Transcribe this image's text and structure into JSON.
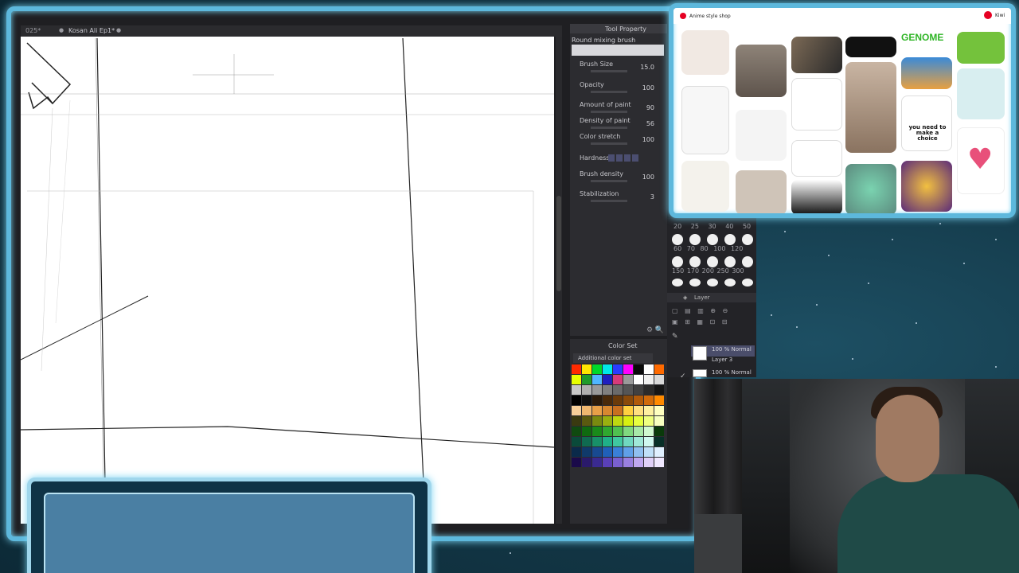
{
  "canvas_tabs": [
    {
      "label": "025*",
      "active": false
    },
    {
      "label": "Kosan Ali Ep1*",
      "active": true
    }
  ],
  "tool_property": {
    "title": "Tool Property",
    "brush_name": "Round mixing brush",
    "properties": [
      {
        "label": "Brush Size",
        "value": "15.0"
      },
      {
        "label": "Opacity",
        "value": "100"
      },
      {
        "label": "Amount of paint",
        "value": "90"
      },
      {
        "label": "Density of paint",
        "value": "56"
      },
      {
        "label": "Color stretch",
        "value": "100"
      },
      {
        "label": "Hardness",
        "value": ""
      },
      {
        "label": "Brush density",
        "value": "100"
      },
      {
        "label": "Stabilization",
        "value": "3"
      }
    ]
  },
  "brush_sizes": {
    "row1": [
      "20",
      "25",
      "30",
      "40",
      "50"
    ],
    "row2": [
      "60",
      "70",
      "80",
      "100",
      "120"
    ],
    "row3": [
      "150",
      "170",
      "200",
      "250",
      "300"
    ]
  },
  "layer_panel": {
    "title": "Layer",
    "layers": [
      {
        "mode": "100 % Normal",
        "name": "Layer 3"
      },
      {
        "mode": "100 % Normal",
        "name": ""
      }
    ]
  },
  "color_set": {
    "title": "Color Set",
    "selected_set": "Additional color set",
    "swatches": [
      "#ff2a00",
      "#ffe500",
      "#00d82a",
      "#00e8e8",
      "#2a3bff",
      "#ff00ff",
      "#0a0a0a",
      "#ffffff",
      "#ff6a00",
      "#e8ff00",
      "#1f9b2a",
      "#4fb6ff",
      "#1f1fbf",
      "#d63a7a",
      "#9a9a9a",
      "#ffffff",
      "#f0f0f0",
      "#d9d9d9",
      "#c8c8c8",
      "#b0b0b0",
      "#999999",
      "#808080",
      "#6a6a6a",
      "#555555",
      "#404040",
      "#2a2a2a",
      "#151515",
      "#000000",
      "#111111",
      "#2a1a0a",
      "#4a2a0a",
      "#6a3a0a",
      "#8a4a0a",
      "#b05a0a",
      "#d06a0a",
      "#ff8a00",
      "#f8d09a",
      "#f0b870",
      "#e8a048",
      "#d88830",
      "#c87020",
      "#ffd040",
      "#ffe080",
      "#fff0a0",
      "#ffffc0",
      "#3a3a10",
      "#5a5a10",
      "#7a8a10",
      "#9ab010",
      "#c0d810",
      "#d8f010",
      "#e8ff40",
      "#f0ff80",
      "#f8ffc0",
      "#104a10",
      "#106a10",
      "#1a8a1a",
      "#30a830",
      "#50c050",
      "#80d880",
      "#a8e8a8",
      "#d0f8d0",
      "#0a3a0a",
      "#0a4a3a",
      "#106a50",
      "#189068",
      "#20b088",
      "#40c8a0",
      "#70d8c0",
      "#a0e8d8",
      "#d0f8f0",
      "#083028",
      "#0a2a4a",
      "#103a6a",
      "#184a90",
      "#2060b8",
      "#3a80d8",
      "#60a0e8",
      "#90c0f0",
      "#c0e0f8",
      "#e0f0ff",
      "#1a0a4a",
      "#2a1a6a",
      "#3a2a90",
      "#5a40b8",
      "#7a60d0",
      "#9a80e0",
      "#c0a8f0",
      "#e0d0f8",
      "#f0e8ff"
    ]
  },
  "browser": {
    "board_title": "Anime style shop",
    "genome_text": "GENOME",
    "pin_caption_1": "you need to make a choice",
    "avatar_label": "Kiwi"
  },
  "colors": {
    "frame_accent": "#5db8dc",
    "app_dark": "#2c2c30",
    "canvas": "#ffffff"
  }
}
